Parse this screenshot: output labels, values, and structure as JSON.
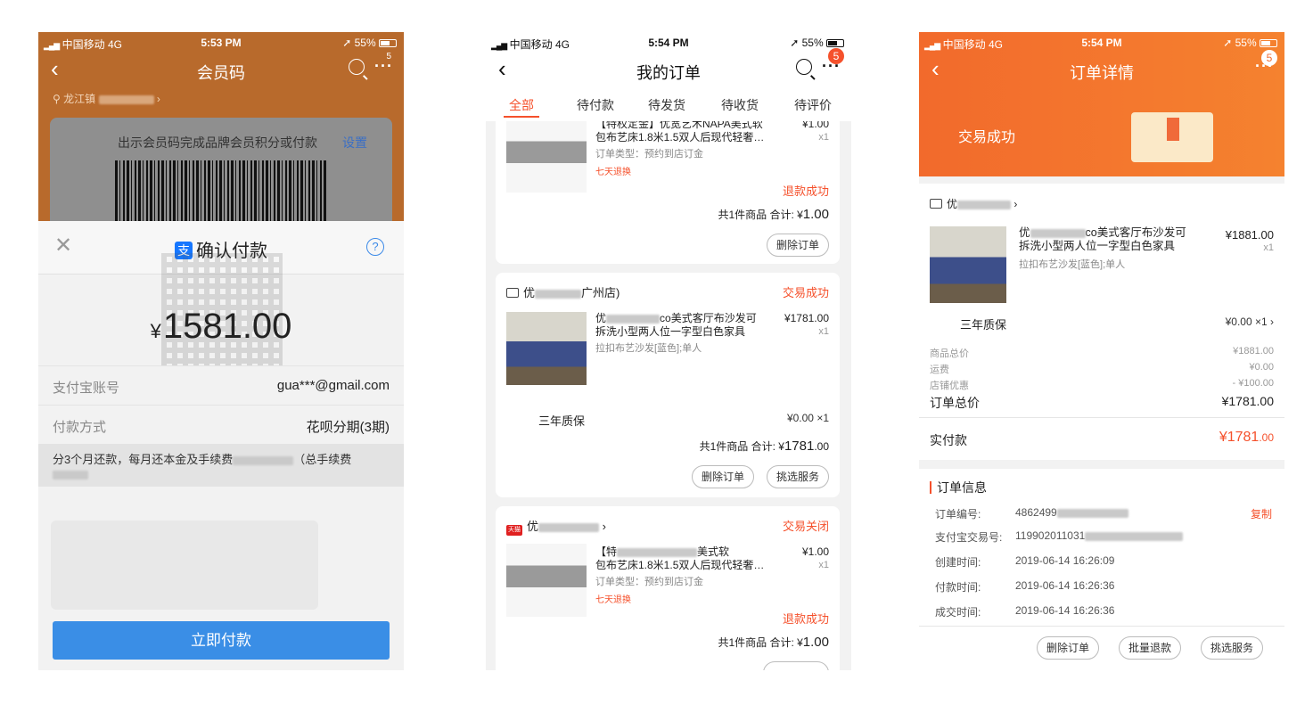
{
  "status1": {
    "carrier": "中国移动",
    "network": "4G",
    "time": "5:53 PM",
    "battery": "55%"
  },
  "status2": {
    "carrier": "中国移动",
    "network": "4G",
    "time": "5:54 PM",
    "battery": "55%"
  },
  "status3": {
    "carrier": "中国移动",
    "network": "4G",
    "time": "5:54 PM",
    "battery": "55%"
  },
  "screen1": {
    "nav_title": "会员码",
    "badge": "5",
    "location": "龙江镇",
    "member_hint": "出示会员码完成品牌会员积分或付款",
    "settings": "设置",
    "sheet_title": "确认付款",
    "zhi_glyph": "支",
    "amount_symbol": "¥",
    "amount": "1581.00",
    "account_label": "支付宝账号",
    "account_value": "gua***@gmail.com",
    "method_label": "付款方式",
    "method_value": "花呗分期(3期)",
    "installment_note": "分3个月还款，每月还本金及手续费",
    "fee_note": "（总手续费",
    "pay_button": "立即付款"
  },
  "screen2": {
    "nav_title": "我的订单",
    "badge": "5",
    "tabs": [
      "全部",
      "待付款",
      "待发货",
      "待收货",
      "待评价"
    ],
    "order1": {
      "name": "【特权定金】优宽艺术NAPA美式软包布艺床1.8米1.5双人后现代轻奢…",
      "price": "¥1.00",
      "qty": "x1",
      "type": "订单类型：预约到店订金",
      "tag": "七天退换",
      "refund": "退款成功",
      "summary_prefix": "共1件商品 合计: ¥",
      "summary_amount": "1.00",
      "btn_delete": "删除订单"
    },
    "order2": {
      "shop_suffix": "广州店)",
      "status": "交易成功",
      "name_prefix": "优",
      "name_suffix": "co美式客厅布沙发可拆洗小型两人位一字型白色家具",
      "price": "¥1781.00",
      "qty": "x1",
      "spec": "拉扣布艺沙发[蓝色];单人",
      "warranty": "三年质保",
      "warranty_price": "¥0.00 ×1",
      "summary_prefix": "共1件商品 合计: ¥",
      "summary_amount": "1781",
      "summary_cents": ".00",
      "btn_delete": "删除订单",
      "btn_service": "挑选服务"
    },
    "order3": {
      "shop_prefix": "优",
      "tmall": "天猫",
      "status": "交易关闭",
      "name_prefix": "【特",
      "name_mid": "美式软",
      "name_line2": "包布艺床1.8米1.5双人后现代轻奢…",
      "price": "¥1.00",
      "qty": "x1",
      "type": "订单类型：预约到店订金",
      "tag": "七天退换",
      "refund": "退款成功",
      "summary_prefix": "共1件商品 合计: ¥",
      "summary_amount": "1.00"
    }
  },
  "screen3": {
    "nav_title": "订单详情",
    "badge": "5",
    "success": "交易成功",
    "shop_prefix": "优",
    "product_prefix": "优",
    "product_suffix": "co美式客厅布沙发可拆洗小型两人位一字型白色家具",
    "price": "¥1881.00",
    "qty": "x1",
    "spec": "拉扣布艺沙发[蓝色];单人",
    "warranty": "三年质保",
    "warranty_price": "¥0.00 ×1",
    "lines": [
      {
        "k": "商品总价",
        "v": "¥1881.00"
      },
      {
        "k": "运费",
        "v": "¥0.00"
      },
      {
        "k": "店铺优惠",
        "v": "- ¥100.00"
      }
    ],
    "total_label": "订单总价",
    "total_value": "¥1781.00",
    "paid_label": "实付款",
    "paid_symbol": "¥",
    "paid_value": "1781",
    "paid_cents": ".00",
    "info_title": "订单信息",
    "info": [
      {
        "k": "订单编号:",
        "v": "4862499"
      },
      {
        "k": "支付宝交易号:",
        "v": "119902011031"
      },
      {
        "k": "创建时间:",
        "v": "2019-06-14 16:26:09"
      },
      {
        "k": "付款时间:",
        "v": "2019-06-14 16:26:36"
      },
      {
        "k": "成交时间:",
        "v": "2019-06-14 16:26:36"
      }
    ],
    "copy": "复制",
    "btn_delete": "删除订单",
    "btn_refund": "批量退款",
    "btn_service": "挑选服务"
  }
}
